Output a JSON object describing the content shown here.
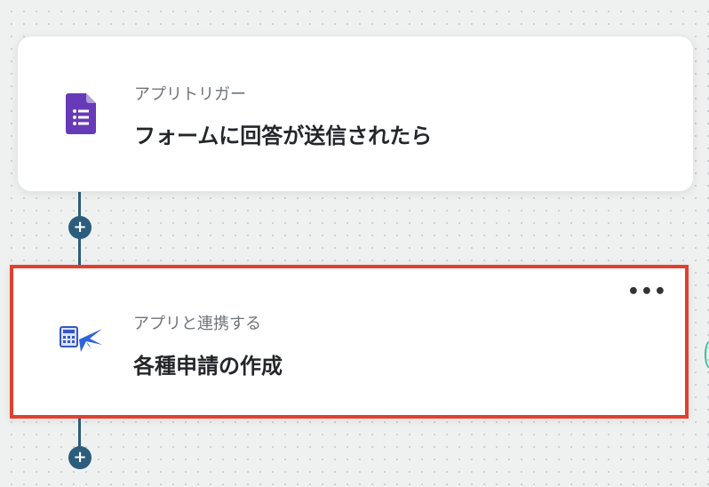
{
  "flow": {
    "steps": [
      {
        "subtitle": "アプリトリガー",
        "title": "フォームに回答が送信されたら",
        "icon": "google-forms-icon"
      },
      {
        "subtitle": "アプリと連携する",
        "title": "各種申請の作成",
        "icon": "expense-app-icon",
        "more_label": "•••",
        "selected": true
      }
    ],
    "add_label": "+"
  },
  "colors": {
    "connector": "#2c5d7c",
    "selection_border": "#e2402f",
    "forms_purple": "#673ab7"
  }
}
